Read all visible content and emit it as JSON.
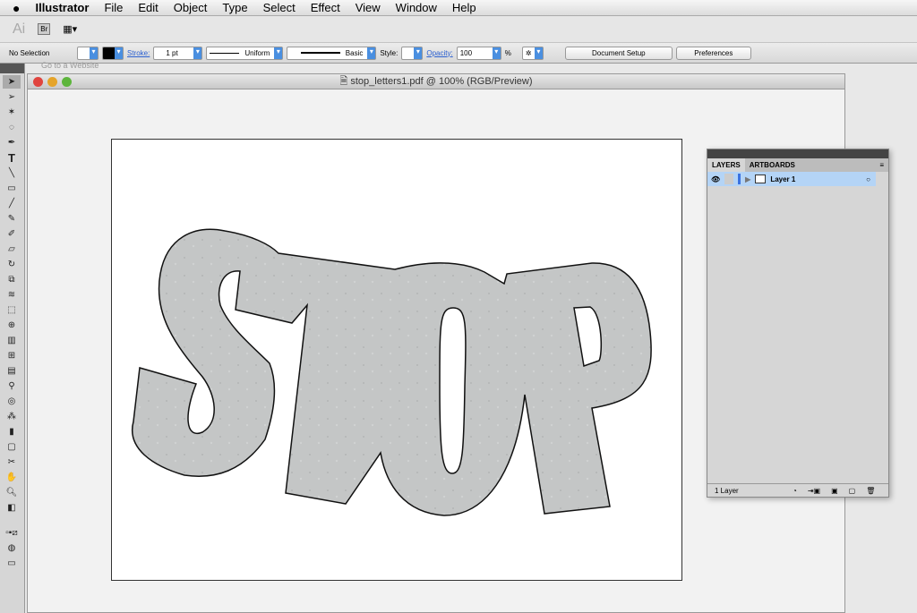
{
  "menu": {
    "apple": "",
    "app": "Illustrator",
    "items": [
      "File",
      "Edit",
      "Object",
      "Type",
      "Select",
      "Effect",
      "View",
      "Window",
      "Help"
    ]
  },
  "appbar": {
    "logo": "Ai",
    "bridge": "Br"
  },
  "control": {
    "selection": "No Selection",
    "stroke_label": "Stroke:",
    "stroke_value": "1 pt",
    "profile": "Uniform",
    "brush": "Basic",
    "style_label": "Style:",
    "opacity_label": "Opacity:",
    "opacity_value": "100",
    "percent": "%",
    "doc_setup": "Document Setup",
    "preferences": "Preferences"
  },
  "hidden_tip": "Go to a Website",
  "document": {
    "title": "stop_letters1.pdf @ 100% (RGB/Preview)",
    "artwork_text": "STOP"
  },
  "layers": {
    "tabs": [
      "LAYERS",
      "ARTBOARDS"
    ],
    "layer_name": "Layer 1",
    "count": "1 Layer"
  }
}
